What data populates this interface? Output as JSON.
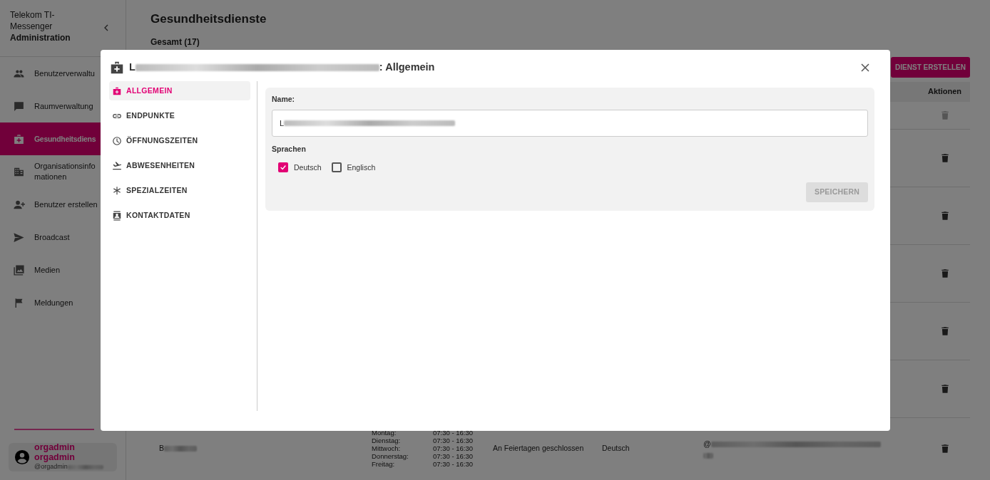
{
  "sidebar": {
    "title_lines": [
      "Telekom TI-",
      "Messenger"
    ],
    "subtitle": "Administration",
    "items": [
      {
        "lines": [
          "Benutzerverwaltu"
        ],
        "selected": false
      },
      {
        "lines": [
          "Raumverwaltung"
        ],
        "selected": false
      },
      {
        "lines": [
          "Gesundheitsdiens"
        ],
        "selected": true
      },
      {
        "lines": [
          "Organisationsinfo",
          "mationen"
        ],
        "selected": false
      },
      {
        "lines": [
          "Benutzer erstellen"
        ],
        "selected": false
      },
      {
        "lines": [
          "Broadcast"
        ],
        "selected": false
      },
      {
        "lines": [
          "Medien"
        ],
        "selected": false
      },
      {
        "lines": [
          "Meldungen"
        ],
        "selected": false
      }
    ],
    "user": {
      "name": "orgadmin orgadmin",
      "handle": "@orgadmin"
    }
  },
  "page": {
    "title": "Gesundheitsdienste",
    "total": "Gesamt (17)",
    "create_button": "DIENST ERSTELLEN",
    "table": {
      "columns": [
        "Aktionen"
      ],
      "rows": [
        {
          "disabled": true
        },
        {
          "disabled": false
        },
        {
          "disabled": false
        },
        {
          "disabled": false
        },
        {
          "disabled": false
        },
        {
          "disabled": false
        },
        {
          "disabled": false,
          "name": "B",
          "schedule": [
            {
              "day": "Montag:",
              "time": "07:30 - 16:30"
            },
            {
              "day": "Dienstag:",
              "time": "07:30 - 16:30"
            },
            {
              "day": "Mittwoch:",
              "time": "07:30 - 16:30"
            },
            {
              "day": "Donnerstag:",
              "time": "07:30 - 16:30"
            },
            {
              "day": "Freitag:",
              "time": "07:30 - 16:30"
            }
          ],
          "note": "An Feiertagen geschlossen",
          "language": "Deutsch",
          "user_id": "@"
        }
      ]
    }
  },
  "dialog": {
    "title": "L",
    "title_suffix": ": Allgemein",
    "tabs": [
      {
        "label": "ALLGEMEIN",
        "selected": true
      },
      {
        "label": "ENDPUNKTE",
        "selected": false
      },
      {
        "label": "ÖFFNUNGSZEITEN",
        "selected": false
      },
      {
        "label": "ABWESENHEITEN",
        "selected": false
      },
      {
        "label": "SPEZIALZEITEN",
        "selected": false
      },
      {
        "label": "KONTAKTDATEN",
        "selected": false
      }
    ],
    "form": {
      "name_label": "Name:",
      "name_value": "L",
      "languages_label": "Sprachen",
      "languages": [
        {
          "label": "Deutsch",
          "checked": true
        },
        {
          "label": "Englisch",
          "checked": false
        }
      ],
      "save_button": {
        "label": "SPEICHERN",
        "disabled": true
      }
    }
  }
}
